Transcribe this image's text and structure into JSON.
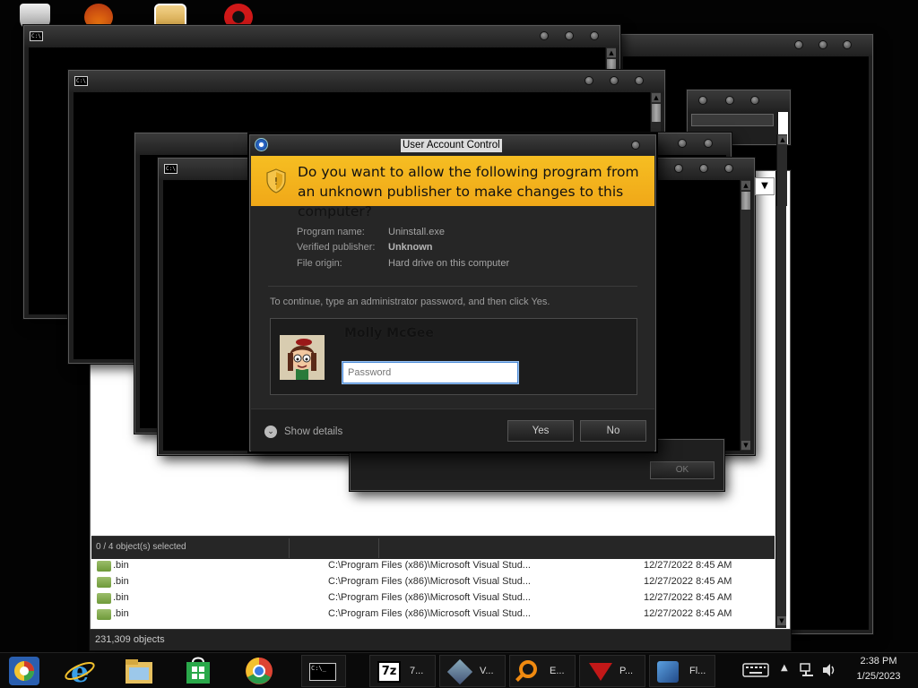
{
  "uac": {
    "title": "User Account Control",
    "question": "Do you want to allow the following program from an unknown publisher to make changes to this computer?",
    "program_name_label": "Program name:",
    "program_name": "Uninstall.exe",
    "publisher_label": "Verified publisher:",
    "publisher": "Unknown",
    "origin_label": "File origin:",
    "origin": "Hard drive on this computer",
    "instruction": "To continue, type an administrator password, and then click Yes.",
    "user_name": "Molly McGee",
    "password_placeholder": "Password",
    "show_details": "Show details",
    "yes": "Yes",
    "no": "No"
  },
  "dialog_ok": "OK",
  "explorer": {
    "selection_status": "0 / 4 object(s) selected",
    "objects_status": "231,309 objects",
    "rows": [
      {
        "name": ".bin",
        "path": "C:\\Program Files (x86)\\Microsoft Visual Stud...",
        "date": "12/27/2022 8:45 AM"
      },
      {
        "name": ".bin",
        "path": "C:\\Program Files (x86)\\Microsoft Visual Stud...",
        "date": "12/27/2022 8:45 AM"
      },
      {
        "name": ".bin",
        "path": "C:\\Program Files (x86)\\Microsoft Visual Stud...",
        "date": "12/27/2022 8:45 AM"
      },
      {
        "name": ".bin",
        "path": "C:\\Program Files (x86)\\Microsoft Visual Stud...",
        "date": "12/27/2022 8:45 AM"
      }
    ]
  },
  "taskbar": {
    "items": [
      "7...",
      "V...",
      "E...",
      "P...",
      "Fl..."
    ],
    "time": "2:38 PM",
    "date": "1/25/2023"
  },
  "icons": [
    "cmd-icon",
    "uac-shield-icon",
    "details-chevron-icon",
    "start-icon",
    "ie-icon",
    "file-explorer-icon",
    "store-icon",
    "chrome-icon",
    "keyboard-icon",
    "network-icon",
    "volume-icon"
  ],
  "colors": {
    "uac_banner": "#f3b21d",
    "password_focus": "#4a8ad8"
  }
}
